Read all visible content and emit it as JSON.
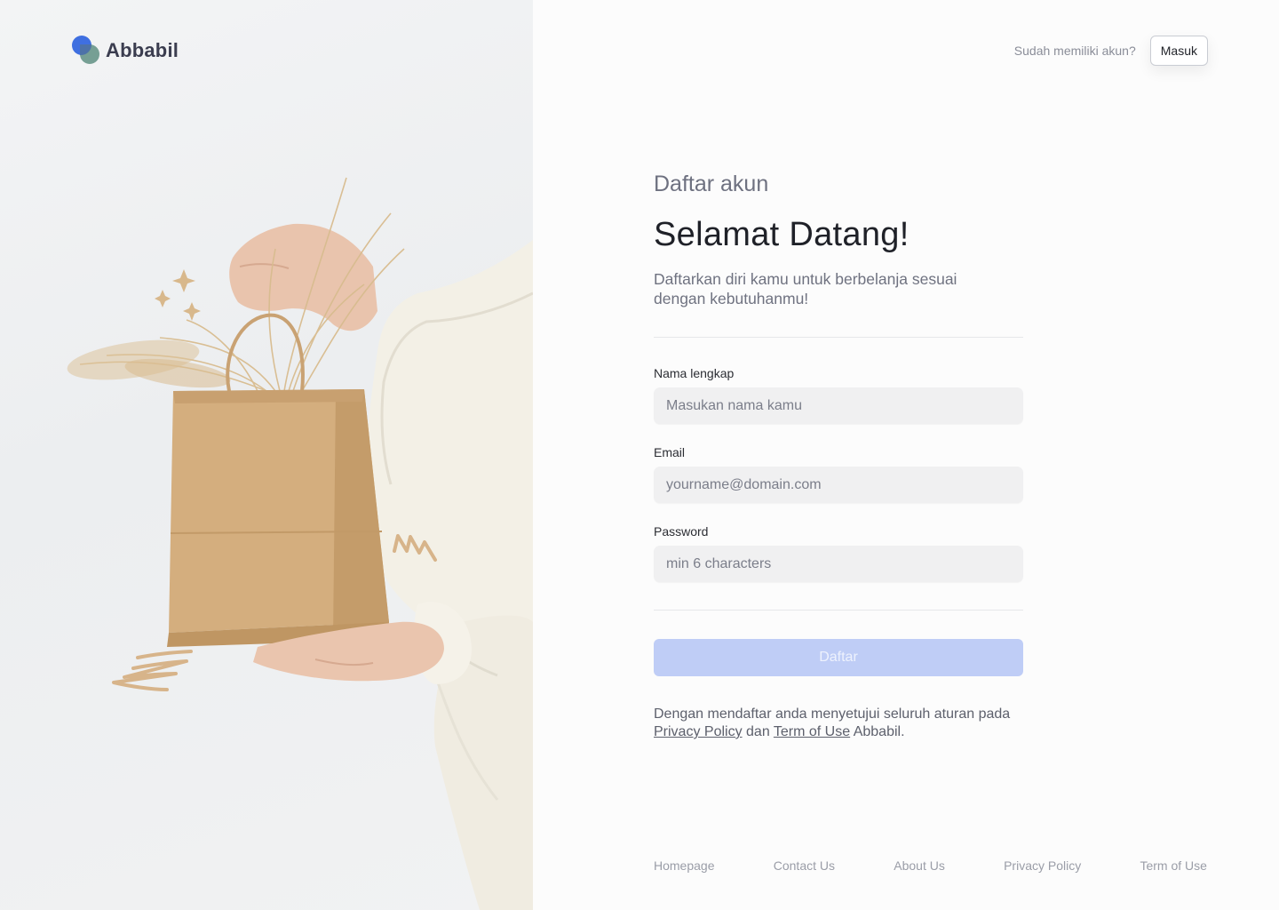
{
  "brand": {
    "name": "Abbabil"
  },
  "colors": {
    "primary": "#3f6fe0",
    "button_disabled": "#bfcdf6",
    "input_bg": "#f0f0f1",
    "bag": "#d4ae7e"
  },
  "header": {
    "prompt": "Sudah memiliki akun?",
    "login_label": "Masuk"
  },
  "form": {
    "eyebrow": "Daftar akun",
    "title": "Selamat Datang!",
    "subtitle": "Daftarkan diri kamu untuk berbelanja sesuai dengan kebutuhanmu!",
    "fields": [
      {
        "label": "Nama lengkap",
        "placeholder": "Masukan nama kamu"
      },
      {
        "label": "Email",
        "placeholder": "yourname@domain.com"
      },
      {
        "label": "Password",
        "placeholder": "min 6 characters"
      }
    ],
    "submit_label": "Daftar",
    "terms": {
      "prefix": "Dengan mendaftar anda menyetujui seluruh aturan pada",
      "privacy_link": "Privacy Policy",
      "and": "dan",
      "terms_link": "Term of Use",
      "suffix": "Abbabil."
    }
  },
  "footer": {
    "links": [
      "Homepage",
      "Contact Us",
      "About Us",
      "Privacy Policy",
      "Term of Use"
    ]
  },
  "icons": [
    "logo-mark-icon",
    "sparkle-icon",
    "squiggle-icon"
  ]
}
